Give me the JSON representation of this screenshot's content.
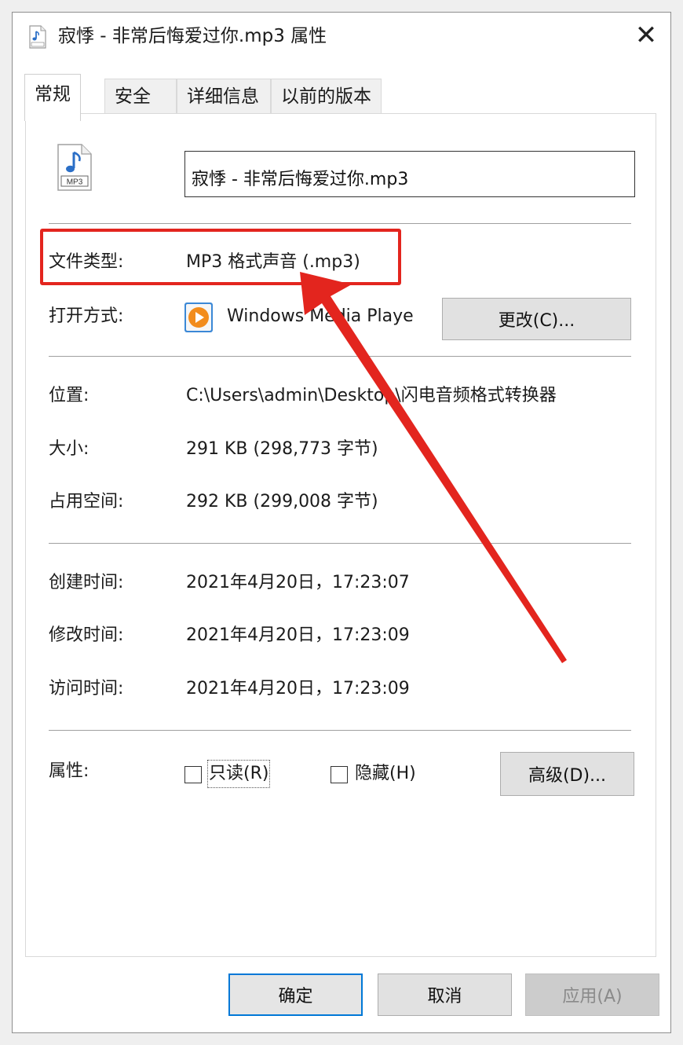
{
  "window": {
    "title": "寂悸 - 非常后悔爱过你.mp3 属性",
    "close_label": "✕"
  },
  "tabs": [
    {
      "label": "常规",
      "active": true
    },
    {
      "label": "安全",
      "active": false
    },
    {
      "label": "详细信息",
      "active": false
    },
    {
      "label": "以前的版本",
      "active": false
    }
  ],
  "file": {
    "icon_text": "MP3",
    "name": "寂悸 - 非常后悔爱过你.mp3"
  },
  "properties": {
    "file_type_label": "文件类型:",
    "file_type_value": "MP3 格式声音 (.mp3)",
    "open_with_label": "打开方式:",
    "open_with_value": "Windows Media Playe",
    "change_button": "更改(C)...",
    "location_label": "位置:",
    "location_value": "C:\\Users\\admin\\Desktop\\闪电音频格式转换器",
    "size_label": "大小:",
    "size_value": "291 KB (298,773 字节)",
    "size_on_disk_label": "占用空间:",
    "size_on_disk_value": "292 KB (299,008 字节)",
    "created_label": "创建时间:",
    "created_value": "2021年4月20日，17:23:07",
    "modified_label": "修改时间:",
    "modified_value": "2021年4月20日，17:23:09",
    "accessed_label": "访问时间:",
    "accessed_value": "2021年4月20日，17:23:09",
    "attributes_label": "属性:",
    "readonly_label": "只读(R)",
    "hidden_label": "隐藏(H)",
    "advanced_button": "高级(D)..."
  },
  "buttons": {
    "ok": "确定",
    "cancel": "取消",
    "apply": "应用(A)"
  },
  "colors": {
    "annotation_red": "#e3251e",
    "ok_border": "#0078d7",
    "button_face": "#e1e1e1",
    "disabled_text": "#8a8a8a"
  },
  "icons": {
    "title": "mp3-file-icon",
    "file": "mp3-file-icon",
    "open_with": "windows-media-player-icon",
    "close": "close-icon"
  }
}
